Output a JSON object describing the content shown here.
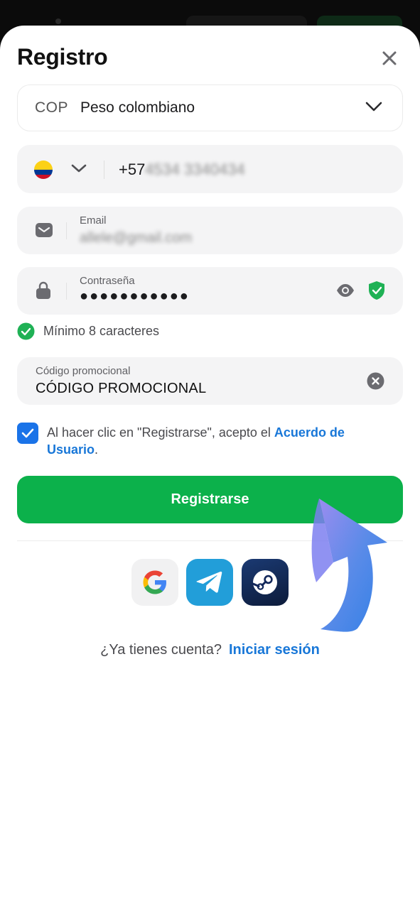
{
  "title": "Registro",
  "currency": {
    "code": "COP",
    "name": "Peso colombiano"
  },
  "phone": {
    "prefix": "+57",
    "number": "4534 3340434"
  },
  "email": {
    "label": "Email",
    "value": "allele@gmail.com"
  },
  "password": {
    "label": "Contraseña",
    "value": "●●●●●●●●●●●"
  },
  "password_rule": "Mínimo 8 caracteres",
  "promo": {
    "label": "Código promocional",
    "value": "CÓDIGO PROMOCIONAL"
  },
  "terms": {
    "text": "Al hacer clic en \"Registrarse\", acepto el ",
    "link": "Acuerdo de Usuario",
    "suffix": "."
  },
  "register_button": "Registrarse",
  "social": [
    "google-icon",
    "telegram-icon",
    "steam-icon"
  ],
  "login": {
    "prompt": "¿Ya tienes cuenta?",
    "link": "Iniciar sesión"
  },
  "colors": {
    "primary_green": "#0cb14b",
    "link_blue": "#1877d8",
    "checkbox_blue": "#1a73e8",
    "arrow_blue": "#4f86e8"
  }
}
